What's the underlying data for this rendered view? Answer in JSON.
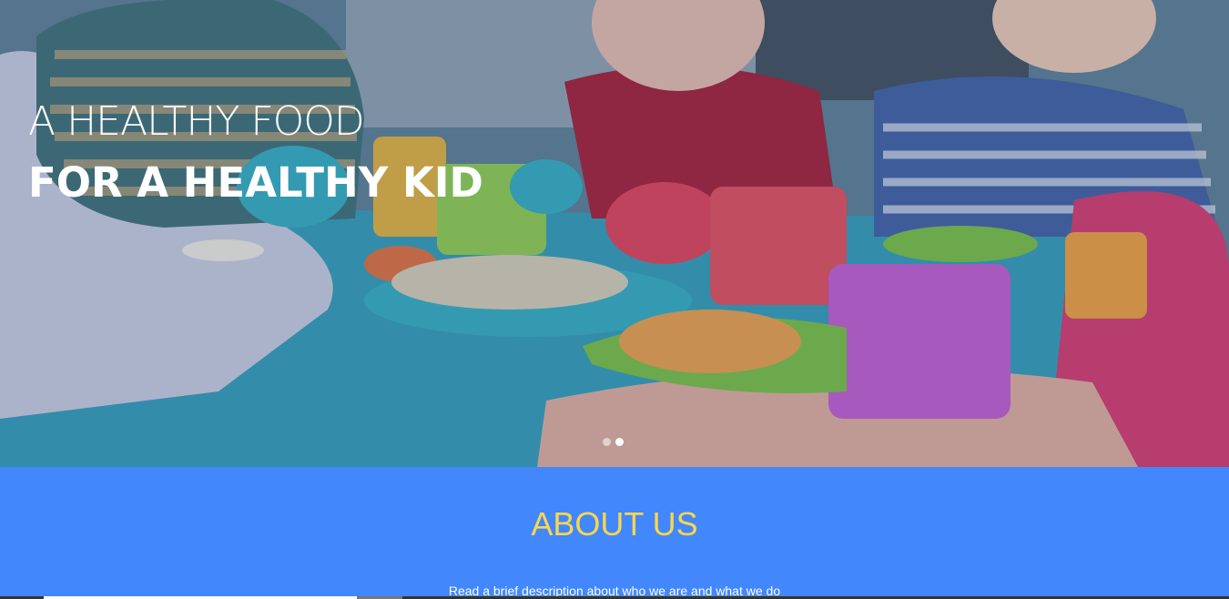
{
  "hero": {
    "title_line1": "A HEALTHY FOOD",
    "title_line2": "FOR A HEALTHY KID",
    "slides": [
      {
        "active": false
      },
      {
        "active": true
      }
    ]
  },
  "about": {
    "title": "ABOUT US",
    "description": "Read a brief description about who we are and what we do"
  },
  "colors": {
    "about_bg": "#4287fc",
    "about_title": "#f9d64c",
    "text": "#ffffff"
  }
}
